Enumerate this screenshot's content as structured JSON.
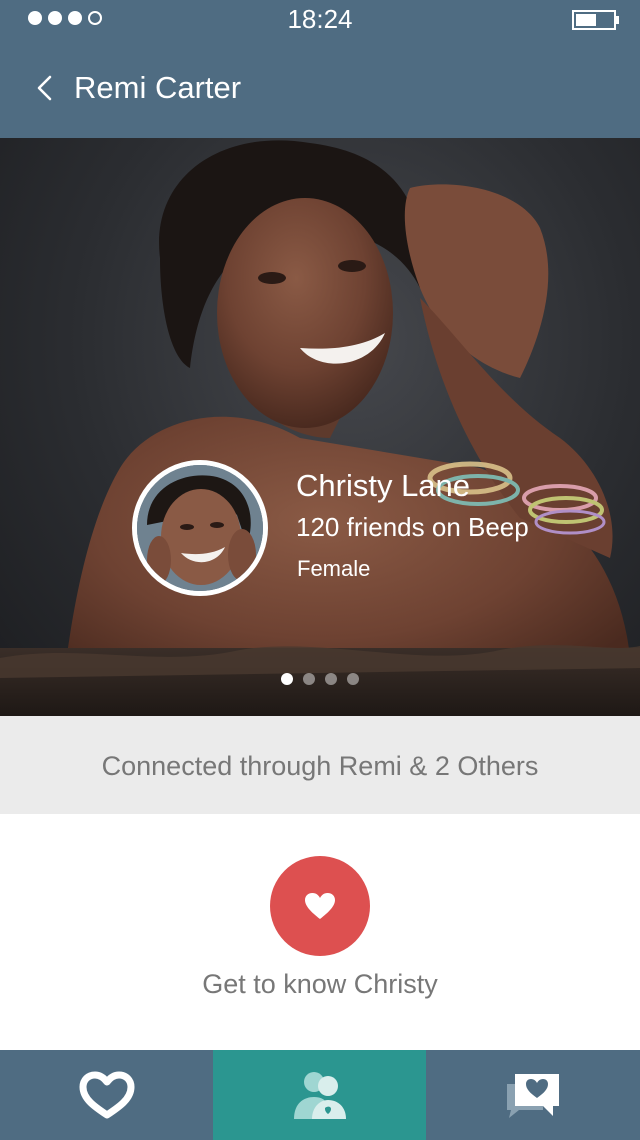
{
  "status_bar": {
    "time": "18:24",
    "signal_dots_filled": 3,
    "signal_dots_total": 4,
    "signal_icon": "signal-dots-icon",
    "battery_icon": "battery-icon"
  },
  "header": {
    "back_icon": "chevron-left-icon",
    "title": "Remi Carter"
  },
  "profile": {
    "name": "Christy Lane",
    "friends": "120 friends on Beep",
    "gender": "Female",
    "photo_count": 4,
    "active_photo": 1
  },
  "connection": {
    "text": "Connected through Remi & 2 Others"
  },
  "action": {
    "icon": "heart-icon",
    "label": "Get to know Christy"
  },
  "tabbar": {
    "tabs": [
      {
        "icon": "heart-logo-icon",
        "active": false
      },
      {
        "icon": "people-icon",
        "active": true
      },
      {
        "icon": "chat-heart-icon",
        "active": false
      }
    ]
  },
  "colors": {
    "header": "#4f6c82",
    "active_tab": "#2b9690",
    "heart_button": "#dd5050",
    "connection_bar": "#ebebeb"
  }
}
